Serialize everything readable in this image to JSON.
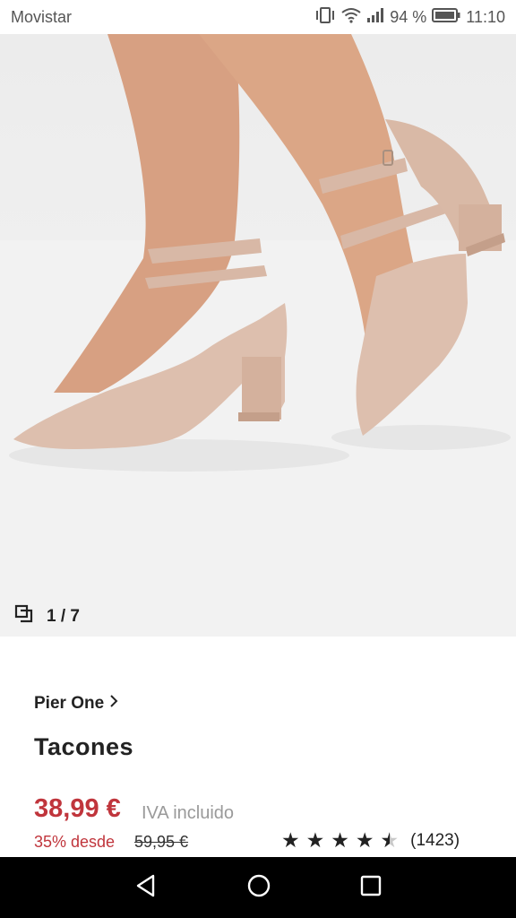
{
  "status_bar": {
    "carrier": "Movistar",
    "battery_percent": "94 %",
    "time": "11:10"
  },
  "gallery": {
    "counter": "1 / 7",
    "image_description_icon": "gallery-icon"
  },
  "product": {
    "brand": "Pier One",
    "title": "Tacones",
    "price": "38,99 €",
    "vat_note": "IVA incluido",
    "discount": "35% desde",
    "original_price": "59,95 €",
    "rating_count": "(1423)",
    "rating_value": 4.5
  },
  "colors": {
    "price_red": "#c0353c",
    "shoe": "#ddbfae",
    "skin": "#d9a283"
  },
  "nav_bar": {
    "icons": [
      "back-icon",
      "home-icon",
      "recents-icon"
    ]
  }
}
